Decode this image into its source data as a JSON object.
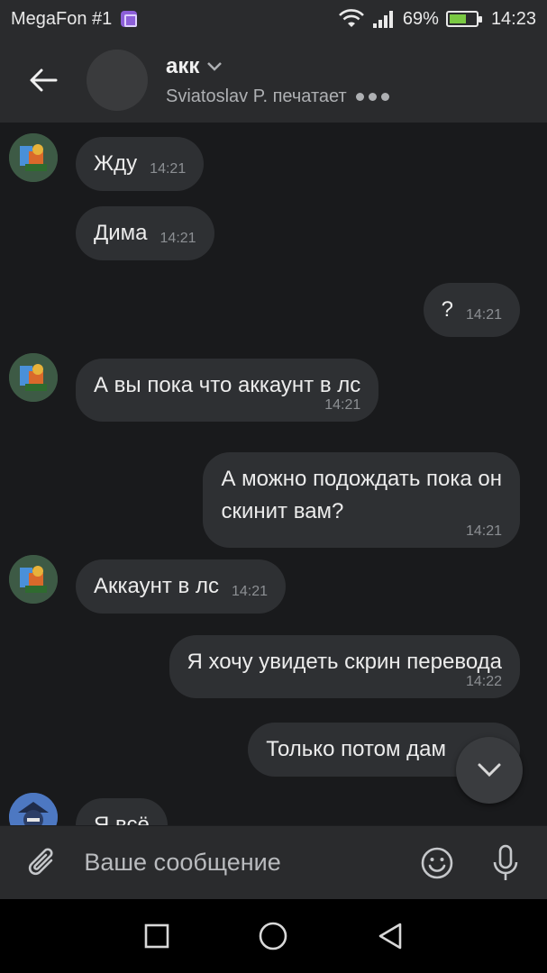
{
  "status_bar": {
    "carrier": "MegaFon #1",
    "battery_percent": "69%",
    "battery_level": 0.69,
    "time": "14:23",
    "icons": [
      "app-badge-icon",
      "wifi-icon",
      "signal-icon",
      "battery-icon"
    ]
  },
  "header": {
    "title": "акк",
    "subtitle": "Sviatoslav P. печатает"
  },
  "messages": [
    {
      "id": 1,
      "direction": "incoming",
      "text": "Жду",
      "time": "14:21",
      "show_avatar": true
    },
    {
      "id": 2,
      "direction": "incoming",
      "text": "Дима",
      "time": "14:21",
      "show_avatar": false
    },
    {
      "id": 3,
      "direction": "outgoing",
      "text": "?",
      "time": "14:21"
    },
    {
      "id": 4,
      "direction": "incoming",
      "text": "А вы пока что аккаунт в лс",
      "time": "14:21",
      "show_avatar": true
    },
    {
      "id": 5,
      "direction": "outgoing",
      "text_lines": [
        "А можно подождать пока он",
        "скинит вам?"
      ],
      "time": "14:21"
    },
    {
      "id": 6,
      "direction": "incoming",
      "text": "Аккаунт в лс",
      "time": "14:21",
      "show_avatar": true
    },
    {
      "id": 7,
      "direction": "outgoing",
      "text": "Я хочу увидеть скрин перевода",
      "time": "14:22"
    },
    {
      "id": 8,
      "direction": "outgoing",
      "text": "Только потом дам",
      "time": ""
    },
    {
      "id": 9,
      "direction": "incoming",
      "text": "Я всё",
      "time": "",
      "show_avatar": true,
      "partially_visible": true
    }
  ],
  "composer": {
    "placeholder": "Ваше сообщение"
  },
  "colors": {
    "background": "#191a1c",
    "header": "#2a2b2d",
    "bubble": "#2e3033",
    "navbar": "#000000",
    "battery_fill": "#7ac943"
  },
  "nav_icons": [
    "recent-apps-icon",
    "home-icon",
    "back-nav-icon"
  ]
}
